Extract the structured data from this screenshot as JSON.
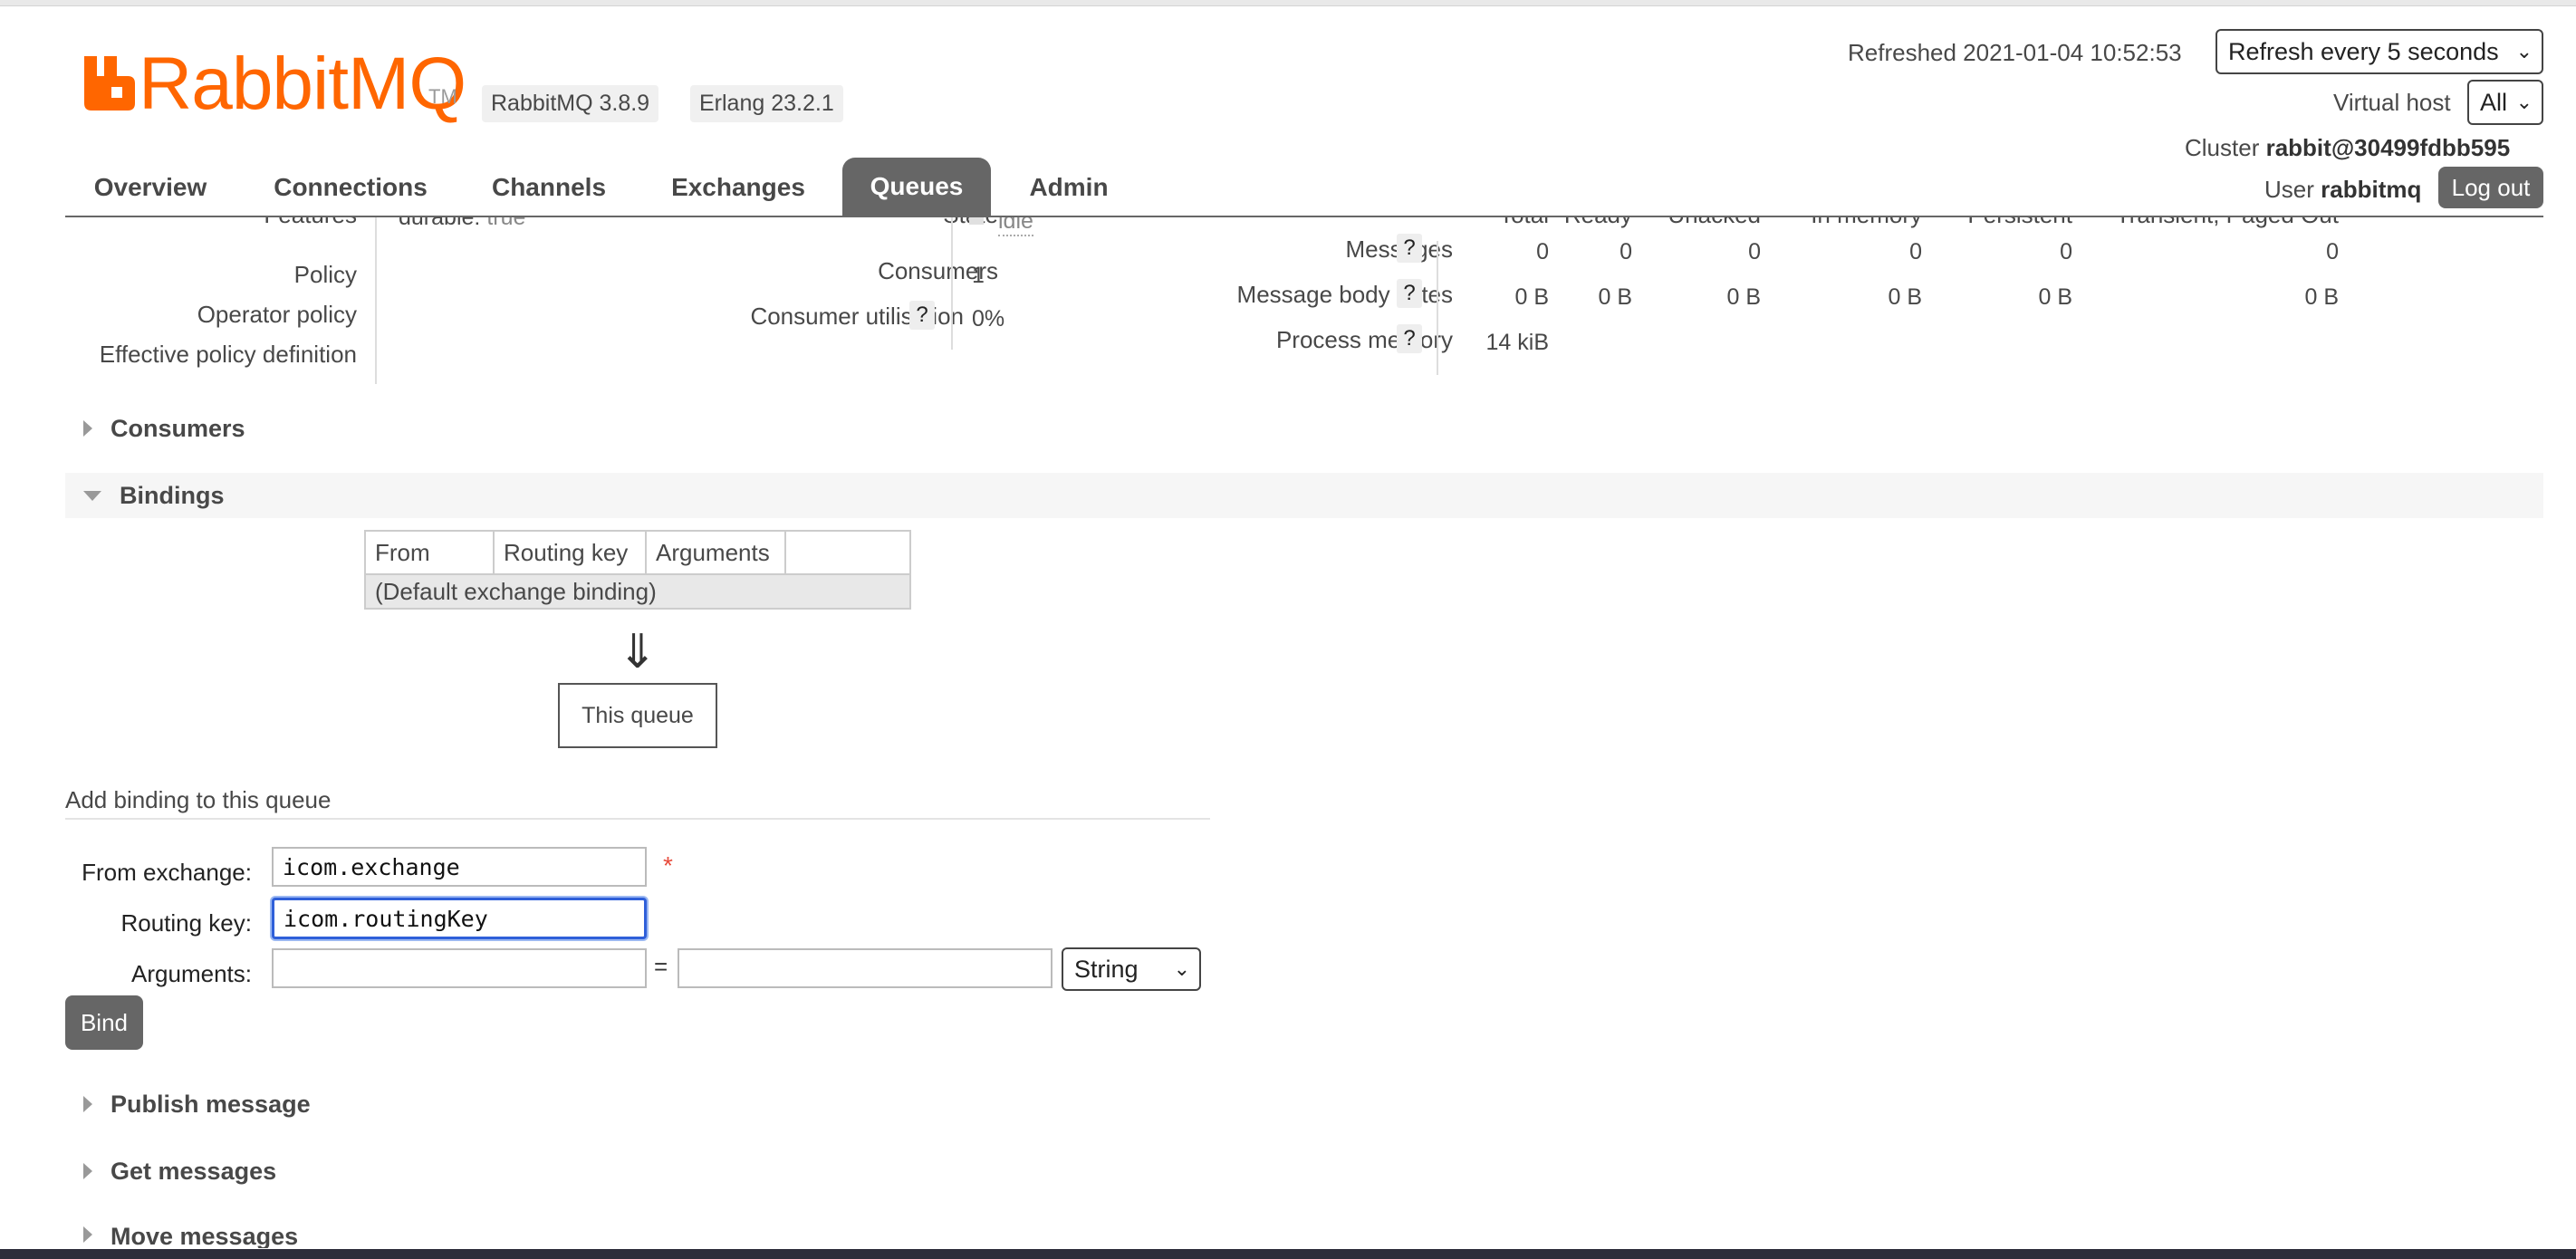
{
  "header": {
    "brand_rabbit": "Rabbit",
    "brand_mq": "MQ",
    "brand_tm": "TM",
    "version_badge": "RabbitMQ 3.8.9",
    "erlang_badge": "Erlang 23.2.1",
    "refreshed_label": "Refreshed 2021-01-04 10:52:53",
    "refresh_select": "Refresh every 5 seconds",
    "vhost_label": "Virtual host",
    "vhost_select": "All",
    "cluster_label": "Cluster",
    "cluster_name": "rabbit@30499fdbb595",
    "user_label": "User",
    "user_name": "rabbitmq",
    "logout_label": "Log out"
  },
  "nav": {
    "items": [
      "Overview",
      "Connections",
      "Channels",
      "Exchanges",
      "Queues",
      "Admin"
    ],
    "active": "Queues"
  },
  "details": {
    "features_label": "Features",
    "features_key": "durable:",
    "features_value": "true",
    "policy_label": "Policy",
    "operator_policy_label": "Operator policy",
    "effective_policy_label": "Effective policy definition",
    "state_label": "State",
    "state_value": "idle",
    "consumers_label": "Consumers",
    "consumers_value": "1",
    "utilisation_label": "Consumer utilisation",
    "utilisation_value": "0%",
    "help": "?",
    "stats_columns": [
      "Total",
      "Ready",
      "Unacked",
      "In memory",
      "Persistent",
      "Transient, Paged Out"
    ],
    "messages_label": "Messages",
    "messages_values": [
      "0",
      "0",
      "0",
      "0",
      "0",
      "0"
    ],
    "body_bytes_label": "Message body bytes",
    "body_bytes_values": [
      "0 B",
      "0 B",
      "0 B",
      "0 B",
      "0 B",
      "0 B"
    ],
    "process_memory_label": "Process memory",
    "process_memory_value": "14 kiB"
  },
  "sections": {
    "consumers": "Consumers",
    "bindings": "Bindings",
    "publish": "Publish message",
    "get": "Get messages",
    "move": "Move messages"
  },
  "bindings": {
    "columns": [
      "From",
      "Routing key",
      "Arguments"
    ],
    "row": "(Default exchange binding)",
    "arrow": "⇓",
    "this_queue": "This queue"
  },
  "form": {
    "title": "Add binding to this queue",
    "from_label": "From exchange:",
    "from_value": "icom.exchange",
    "required_mark": "*",
    "routing_label": "Routing key:",
    "routing_value": "icom.routingKey",
    "args_label": "Arguments:",
    "equals": "=",
    "type_select": "String",
    "bind_label": "Bind"
  }
}
